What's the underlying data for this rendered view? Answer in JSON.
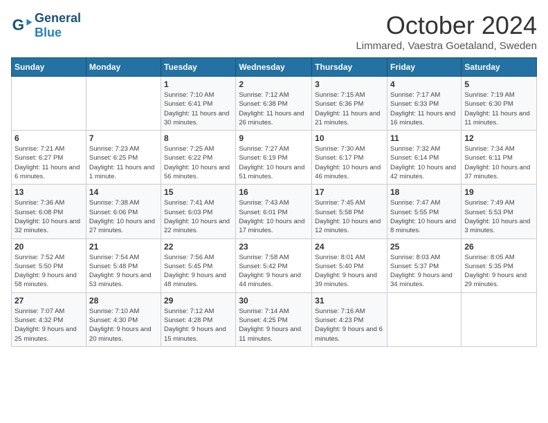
{
  "logo": {
    "general": "General",
    "blue": "Blue"
  },
  "header": {
    "month": "October 2024",
    "location": "Limmared, Vaestra Goetaland, Sweden"
  },
  "weekdays": [
    "Sunday",
    "Monday",
    "Tuesday",
    "Wednesday",
    "Thursday",
    "Friday",
    "Saturday"
  ],
  "weeks": [
    [
      {
        "day": "",
        "detail": ""
      },
      {
        "day": "",
        "detail": ""
      },
      {
        "day": "1",
        "detail": "Sunrise: 7:10 AM\nSunset: 6:41 PM\nDaylight: 11 hours and 30 minutes."
      },
      {
        "day": "2",
        "detail": "Sunrise: 7:12 AM\nSunset: 6:38 PM\nDaylight: 11 hours and 26 minutes."
      },
      {
        "day": "3",
        "detail": "Sunrise: 7:15 AM\nSunset: 6:36 PM\nDaylight: 11 hours and 21 minutes."
      },
      {
        "day": "4",
        "detail": "Sunrise: 7:17 AM\nSunset: 6:33 PM\nDaylight: 11 hours and 16 minutes."
      },
      {
        "day": "5",
        "detail": "Sunrise: 7:19 AM\nSunset: 6:30 PM\nDaylight: 11 hours and 11 minutes."
      }
    ],
    [
      {
        "day": "6",
        "detail": "Sunrise: 7:21 AM\nSunset: 6:27 PM\nDaylight: 11 hours and 6 minutes."
      },
      {
        "day": "7",
        "detail": "Sunrise: 7:23 AM\nSunset: 6:25 PM\nDaylight: 11 hours and 1 minute."
      },
      {
        "day": "8",
        "detail": "Sunrise: 7:25 AM\nSunset: 6:22 PM\nDaylight: 10 hours and 56 minutes."
      },
      {
        "day": "9",
        "detail": "Sunrise: 7:27 AM\nSunset: 6:19 PM\nDaylight: 10 hours and 51 minutes."
      },
      {
        "day": "10",
        "detail": "Sunrise: 7:30 AM\nSunset: 6:17 PM\nDaylight: 10 hours and 46 minutes."
      },
      {
        "day": "11",
        "detail": "Sunrise: 7:32 AM\nSunset: 6:14 PM\nDaylight: 10 hours and 42 minutes."
      },
      {
        "day": "12",
        "detail": "Sunrise: 7:34 AM\nSunset: 6:11 PM\nDaylight: 10 hours and 37 minutes."
      }
    ],
    [
      {
        "day": "13",
        "detail": "Sunrise: 7:36 AM\nSunset: 6:08 PM\nDaylight: 10 hours and 32 minutes."
      },
      {
        "day": "14",
        "detail": "Sunrise: 7:38 AM\nSunset: 6:06 PM\nDaylight: 10 hours and 27 minutes."
      },
      {
        "day": "15",
        "detail": "Sunrise: 7:41 AM\nSunset: 6:03 PM\nDaylight: 10 hours and 22 minutes."
      },
      {
        "day": "16",
        "detail": "Sunrise: 7:43 AM\nSunset: 6:01 PM\nDaylight: 10 hours and 17 minutes."
      },
      {
        "day": "17",
        "detail": "Sunrise: 7:45 AM\nSunset: 5:58 PM\nDaylight: 10 hours and 12 minutes."
      },
      {
        "day": "18",
        "detail": "Sunrise: 7:47 AM\nSunset: 5:55 PM\nDaylight: 10 hours and 8 minutes."
      },
      {
        "day": "19",
        "detail": "Sunrise: 7:49 AM\nSunset: 5:53 PM\nDaylight: 10 hours and 3 minutes."
      }
    ],
    [
      {
        "day": "20",
        "detail": "Sunrise: 7:52 AM\nSunset: 5:50 PM\nDaylight: 9 hours and 58 minutes."
      },
      {
        "day": "21",
        "detail": "Sunrise: 7:54 AM\nSunset: 5:48 PM\nDaylight: 9 hours and 53 minutes."
      },
      {
        "day": "22",
        "detail": "Sunrise: 7:56 AM\nSunset: 5:45 PM\nDaylight: 9 hours and 48 minutes."
      },
      {
        "day": "23",
        "detail": "Sunrise: 7:58 AM\nSunset: 5:42 PM\nDaylight: 9 hours and 44 minutes."
      },
      {
        "day": "24",
        "detail": "Sunrise: 8:01 AM\nSunset: 5:40 PM\nDaylight: 9 hours and 39 minutes."
      },
      {
        "day": "25",
        "detail": "Sunrise: 8:03 AM\nSunset: 5:37 PM\nDaylight: 9 hours and 34 minutes."
      },
      {
        "day": "26",
        "detail": "Sunrise: 8:05 AM\nSunset: 5:35 PM\nDaylight: 9 hours and 29 minutes."
      }
    ],
    [
      {
        "day": "27",
        "detail": "Sunrise: 7:07 AM\nSunset: 4:32 PM\nDaylight: 9 hours and 25 minutes."
      },
      {
        "day": "28",
        "detail": "Sunrise: 7:10 AM\nSunset: 4:30 PM\nDaylight: 9 hours and 20 minutes."
      },
      {
        "day": "29",
        "detail": "Sunrise: 7:12 AM\nSunset: 4:28 PM\nDaylight: 9 hours and 15 minutes."
      },
      {
        "day": "30",
        "detail": "Sunrise: 7:14 AM\nSunset: 4:25 PM\nDaylight: 9 hours and 11 minutes."
      },
      {
        "day": "31",
        "detail": "Sunrise: 7:16 AM\nSunset: 4:23 PM\nDaylight: 9 hours and 6 minutes."
      },
      {
        "day": "",
        "detail": ""
      },
      {
        "day": "",
        "detail": ""
      }
    ]
  ]
}
